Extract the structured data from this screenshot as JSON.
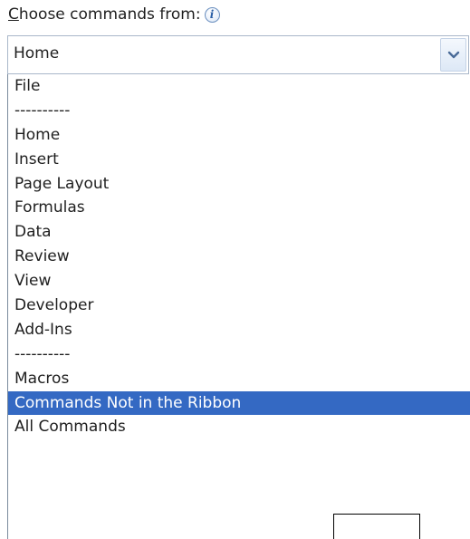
{
  "label": {
    "accel_char": "C",
    "text_rest": "hoose commands from:",
    "info_icon": "info-icon"
  },
  "combo": {
    "selected_value": "Home",
    "button_icon": "chevron-down-icon"
  },
  "list": {
    "items": [
      "File",
      "----------",
      "Home",
      "Insert",
      "Page Layout",
      "Formulas",
      "Data",
      "Review",
      "View",
      "Developer",
      "Add-Ins",
      "----------",
      "Macros",
      "Commands Not in the Ribbon",
      "All Commands",
      "",
      "",
      ""
    ],
    "highlighted_item": "Commands Not in the Ribbon"
  },
  "colors": {
    "highlight_bg": "#3469c3",
    "highlight_text": "#ffffff",
    "combo_border": "#a9b7c9",
    "chevron": "#4a6b98"
  }
}
